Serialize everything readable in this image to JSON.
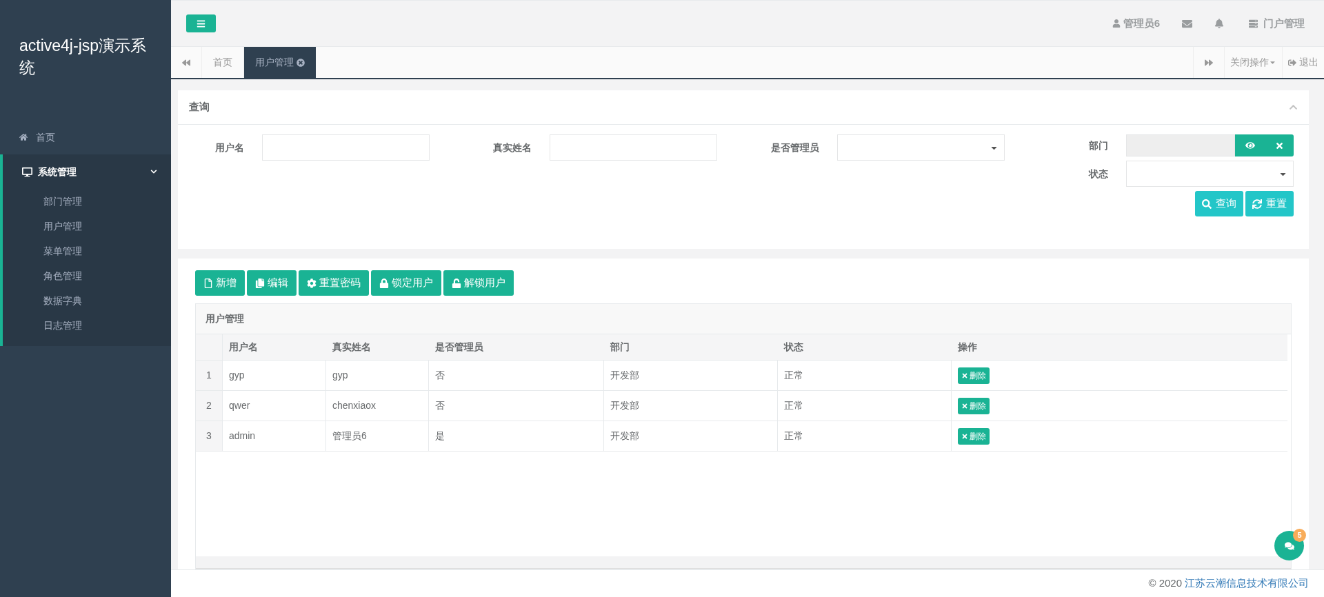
{
  "sidebar": {
    "title": "active4j-jsp演示系统",
    "items": [
      {
        "label": "首页",
        "kind": "link"
      },
      {
        "label": "系统管理",
        "kind": "group",
        "expanded": true,
        "children": [
          {
            "label": "部门管理",
            "selected": false
          },
          {
            "label": "用户管理",
            "selected": false
          },
          {
            "label": "菜单管理",
            "selected": false
          },
          {
            "label": "角色管理",
            "selected": false
          },
          {
            "label": "数据字典",
            "selected": false
          },
          {
            "label": "日志管理",
            "selected": false
          }
        ]
      }
    ]
  },
  "topbar": {
    "user": "管理员6",
    "portal": "门户管理"
  },
  "tabs": [
    {
      "label": "首页",
      "selected": false
    },
    {
      "label": "用户管理",
      "selected": true
    }
  ],
  "tab_actions": {
    "close_menu": "关闭操作",
    "logout": "退出"
  },
  "query": {
    "title": "查询",
    "fields": [
      {
        "label": "用户名",
        "kind": "text"
      },
      {
        "label": "真实姓名",
        "kind": "text"
      },
      {
        "label": "是否管理员",
        "kind": "select"
      },
      {
        "label": "部门",
        "kind": "picker"
      },
      {
        "label": "状态",
        "kind": "select"
      }
    ],
    "buttons": [
      {
        "label": "查询"
      },
      {
        "label": "重置"
      }
    ]
  },
  "toolbar": [
    {
      "label": "新增"
    },
    {
      "label": "编辑"
    },
    {
      "label": "重置密码"
    },
    {
      "label": "锁定用户"
    },
    {
      "label": "解锁用户"
    }
  ],
  "table": {
    "title": "用户管理",
    "columns": [
      "用户名",
      "真实姓名",
      "是否管理员",
      "部门",
      "状态",
      "操作"
    ],
    "rows": [
      {
        "index": "1",
        "cells": [
          "gyp",
          "gyp",
          "否",
          "开发部",
          "正常"
        ],
        "action": "删除"
      },
      {
        "index": "2",
        "cells": [
          "qwer",
          "chenxiaox",
          "否",
          "开发部",
          "正常"
        ],
        "action": "删除"
      },
      {
        "index": "3",
        "cells": [
          "admin",
          "管理员6",
          "是",
          "开发部",
          "正常"
        ],
        "action": "删除"
      }
    ]
  },
  "chat": {
    "badge": "5"
  },
  "footer": {
    "copyright": "© 2020",
    "company": "江苏云潮信息技术有限公司"
  }
}
